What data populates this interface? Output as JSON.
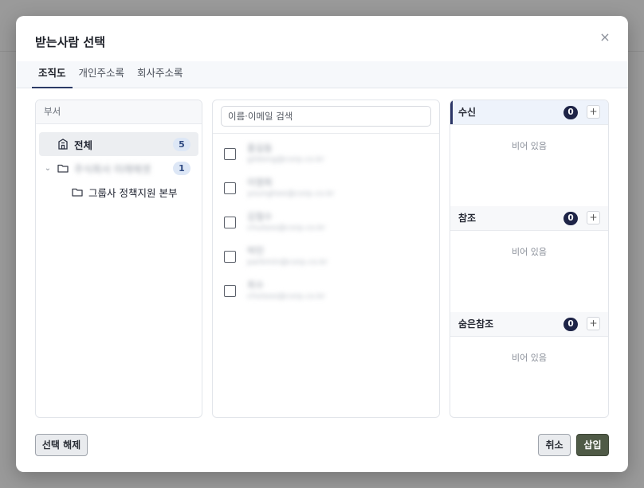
{
  "dialog": {
    "title": "받는사람 선택",
    "close_icon": "×"
  },
  "tabs": [
    {
      "label": "조직도",
      "active": true
    },
    {
      "label": "개인주소록",
      "active": false
    },
    {
      "label": "회사주소록",
      "active": false
    }
  ],
  "departments": {
    "header": "부서",
    "tree": [
      {
        "label": "전체",
        "count": "5",
        "selected": true,
        "icon": "organization-icon"
      },
      {
        "label": "주식회사 미래에셋",
        "count": "1",
        "expanded": true,
        "icon": "folder-icon",
        "blurred": true
      },
      {
        "label": "그룹사 정책지원 본부",
        "icon": "folder-icon"
      }
    ]
  },
  "users": {
    "search_placeholder": "이름·이메일 검색",
    "list": [
      {
        "name": "홍길동",
        "email": "gildong@corp.co.kr"
      },
      {
        "name": "이영희",
        "email": "younghee@corp.co.kr"
      },
      {
        "name": "김철수",
        "email": "chulsoo@corp.co.kr"
      },
      {
        "name": "박민",
        "email": "parkmin@corp.co.kr"
      },
      {
        "name": "최수",
        "email": "choisoo@corp.co.kr"
      }
    ]
  },
  "recipients": {
    "sections": [
      {
        "label": "수신",
        "count": "0",
        "empty_text": "비어 있음",
        "active": true
      },
      {
        "label": "참조",
        "count": "0",
        "empty_text": "비어 있음",
        "active": false
      },
      {
        "label": "숨은참조",
        "count": "0",
        "empty_text": "비어 있음",
        "active": false
      }
    ],
    "add_label": "+"
  },
  "footer": {
    "clear_label": "선택 해제",
    "cancel_label": "취소",
    "insert_label": "삽입"
  },
  "colors": {
    "primary_dark": "#1e2447",
    "insert_button": "#4f5a46",
    "count_pill": "#dde7f6"
  }
}
